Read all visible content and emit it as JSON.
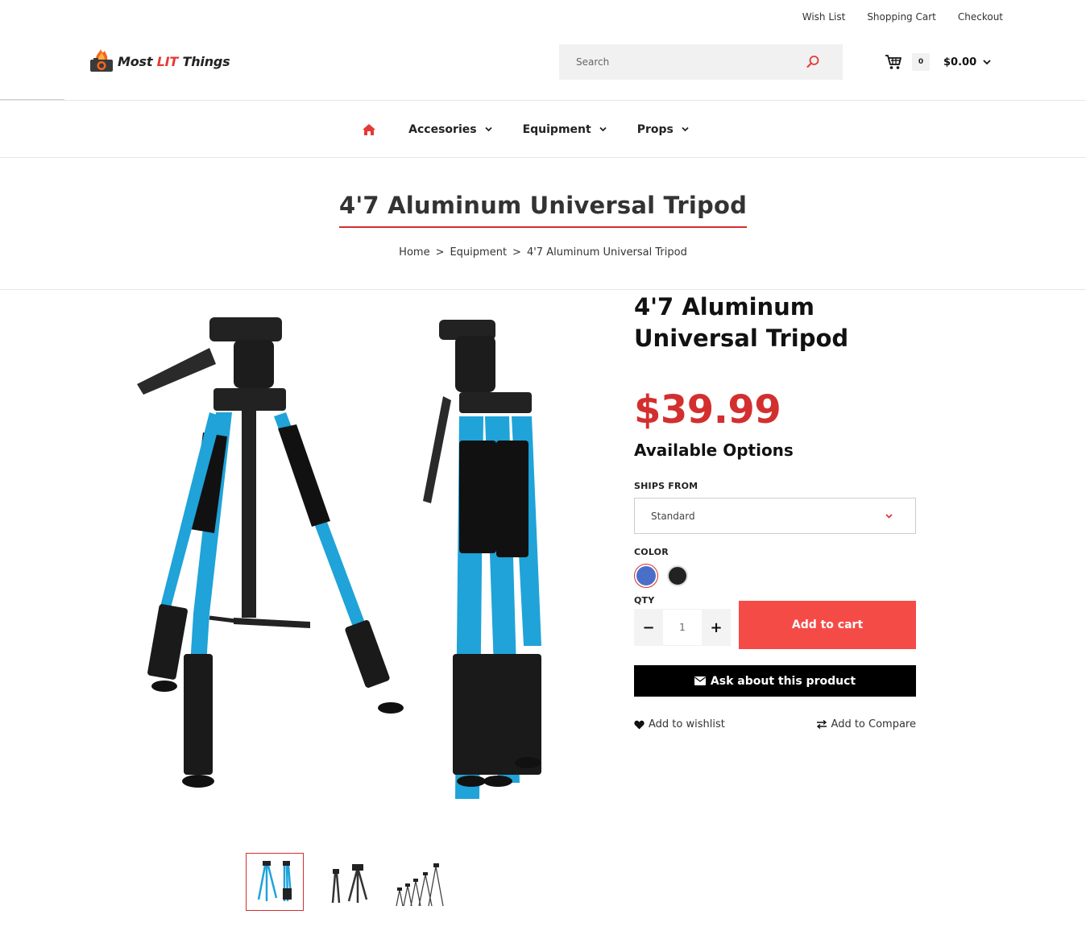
{
  "top_links": [
    "Wish List",
    "Shopping Cart",
    "Checkout"
  ],
  "logo": {
    "part1": "Most ",
    "part2": "LIT",
    "part3": " Things"
  },
  "search": {
    "placeholder": "Search"
  },
  "cart": {
    "count": "0",
    "total": "$0.00"
  },
  "nav": {
    "items": [
      "Accesories",
      "Equipment",
      "Props"
    ]
  },
  "page": {
    "title": "4'7 Aluminum Universal Tripod"
  },
  "breadcrumb": {
    "items": [
      "Home",
      "Equipment",
      "4'7 Aluminum Universal Tripod"
    ],
    "separator": ">"
  },
  "product": {
    "title": "4'7 Aluminum Universal Tripod",
    "price": "$39.99",
    "options_heading": "Available Options",
    "ships_from_label": "SHIPS FROM",
    "ships_from_value": "Standard",
    "color_label": "COLOR",
    "colors": [
      {
        "name": "blue",
        "hex": "#4a6fc9",
        "selected": true
      },
      {
        "name": "black",
        "hex": "#222222",
        "selected": false
      }
    ],
    "qty_label": "QTY",
    "qty_value": "1",
    "qty_minus": "−",
    "qty_plus": "+",
    "add_to_cart": "Add to cart",
    "ask": "Ask about this product",
    "wishlist": "Add to wishlist",
    "compare": "Add to Compare"
  },
  "colors": {
    "accent": "#d32f2f",
    "button_red": "#f54b47",
    "tripod_blue": "#1fa3d8"
  }
}
